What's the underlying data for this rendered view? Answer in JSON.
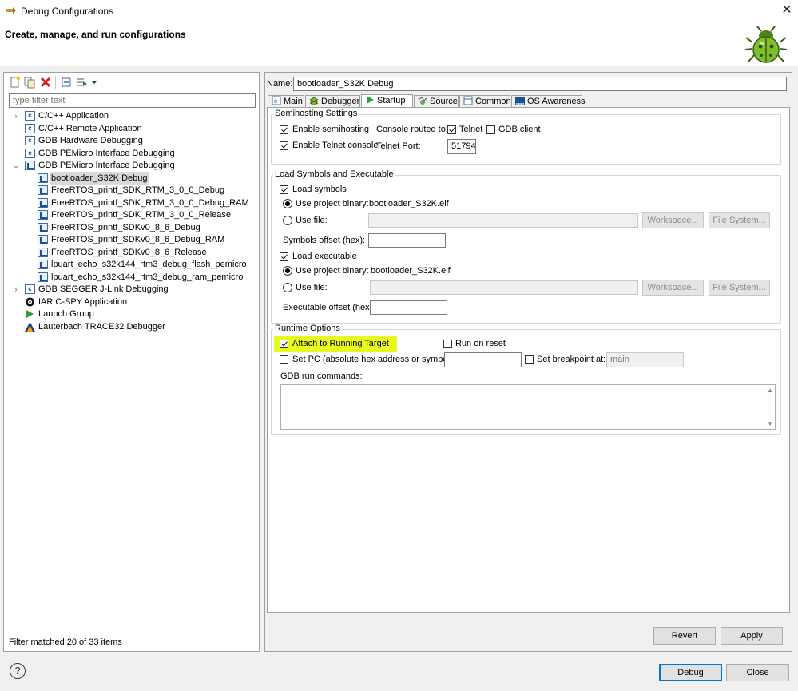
{
  "window": {
    "title": "Debug Configurations",
    "header": "Create, manage, and run configurations",
    "close_glyph": "✕"
  },
  "left": {
    "filter_placeholder": "type filter text",
    "tree": [
      {
        "label": "C/C++ Application",
        "level": 0,
        "twisty": "›",
        "icon": "c-app-icon"
      },
      {
        "label": "C/C++ Remote Application",
        "level": 0,
        "twisty": "",
        "icon": "c-app-icon"
      },
      {
        "label": "GDB Hardware Debugging",
        "level": 0,
        "twisty": "",
        "icon": "c-app-icon"
      },
      {
        "label": "GDB PEMicro Interface Debugging",
        "level": 0,
        "twisty": "",
        "icon": "c-app-icon"
      },
      {
        "label": "GDB PEMicro Interface Debugging",
        "level": 0,
        "twisty": "⌄",
        "icon": "pemicro-icon"
      },
      {
        "label": "bootloader_S32K Debug",
        "level": 1,
        "twisty": "",
        "icon": "pemicro-icon",
        "selected": true
      },
      {
        "label": "FreeRTOS_printf_SDK_RTM_3_0_0_Debug",
        "level": 1,
        "twisty": "",
        "icon": "pemicro-icon"
      },
      {
        "label": "FreeRTOS_printf_SDK_RTM_3_0_0_Debug_RAM",
        "level": 1,
        "twisty": "",
        "icon": "pemicro-icon"
      },
      {
        "label": "FreeRTOS_printf_SDK_RTM_3_0_0_Release",
        "level": 1,
        "twisty": "",
        "icon": "pemicro-icon"
      },
      {
        "label": "FreeRTOS_printf_SDKv0_8_6_Debug",
        "level": 1,
        "twisty": "",
        "icon": "pemicro-icon"
      },
      {
        "label": "FreeRTOS_printf_SDKv0_8_6_Debug_RAM",
        "level": 1,
        "twisty": "",
        "icon": "pemicro-icon"
      },
      {
        "label": "FreeRTOS_printf_SDKv0_8_6_Release",
        "level": 1,
        "twisty": "",
        "icon": "pemicro-icon"
      },
      {
        "label": "lpuart_echo_s32k144_rtm3_debug_flash_pemicro",
        "level": 1,
        "twisty": "",
        "icon": "pemicro-icon"
      },
      {
        "label": "lpuart_echo_s32k144_rtm3_debug_ram_pemicro",
        "level": 1,
        "twisty": "",
        "icon": "pemicro-icon"
      },
      {
        "label": "GDB SEGGER J-Link Debugging",
        "level": 0,
        "twisty": "›",
        "icon": "c-app-icon"
      },
      {
        "label": "IAR C-SPY Application",
        "level": 0,
        "twisty": "",
        "icon": "iar-eye-icon"
      },
      {
        "label": "Launch Group",
        "level": 0,
        "twisty": "",
        "icon": "launch-group-icon"
      },
      {
        "label": "Lauterbach TRACE32 Debugger",
        "level": 0,
        "twisty": "",
        "icon": "trace32-icon"
      }
    ],
    "status": "Filter matched 20 of 33 items"
  },
  "right": {
    "name_label": "Name:",
    "name_value": "bootloader_S32K Debug",
    "tabs": [
      {
        "label": "Main",
        "icon": "main-tab-icon"
      },
      {
        "label": "Debugger",
        "icon": "debugger-tab-icon"
      },
      {
        "label": "Startup",
        "icon": "startup-tab-icon",
        "active": true
      },
      {
        "label": "Source",
        "icon": "source-tab-icon"
      },
      {
        "label": "Common",
        "icon": "common-tab-icon"
      },
      {
        "label": "OS Awareness",
        "icon": "os-tab-icon"
      }
    ],
    "semihosting": {
      "title": "Semihosting Settings",
      "enable_semihosting": "Enable semihosting",
      "enable_telnet": "Enable Telnet console",
      "console_routed": "Console routed to:",
      "telnet": "Telnet",
      "gdb_client": "GDB client",
      "telnet_port_label": "Telnet Port:",
      "telnet_port_value": "51794"
    },
    "load": {
      "title": "Load Symbols and Executable",
      "load_symbols": "Load symbols",
      "use_project_binary": "Use project binary:",
      "binary_name": "bootloader_S32K.elf",
      "use_file": "Use file:",
      "workspace": "Workspace...",
      "file_system": "File System...",
      "symbols_offset": "Symbols offset (hex):",
      "load_executable": "Load executable",
      "executable_offset": "Executable offset (hex):"
    },
    "runtime": {
      "title": "Runtime Options",
      "attach": "Attach to Running Target",
      "run_on_reset": "Run on reset",
      "set_pc": "Set PC (absolute hex address or symbol):",
      "set_breakpoint": "Set breakpoint at:",
      "breakpoint_value": "main",
      "gdb_run_commands": "GDB run commands:"
    },
    "revert": "Revert",
    "apply": "Apply"
  },
  "footer": {
    "help": "?",
    "debug": "Debug",
    "close": "Close"
  },
  "colors": {
    "highlight": "#e7fb20",
    "primary_border": "#0078d7"
  }
}
